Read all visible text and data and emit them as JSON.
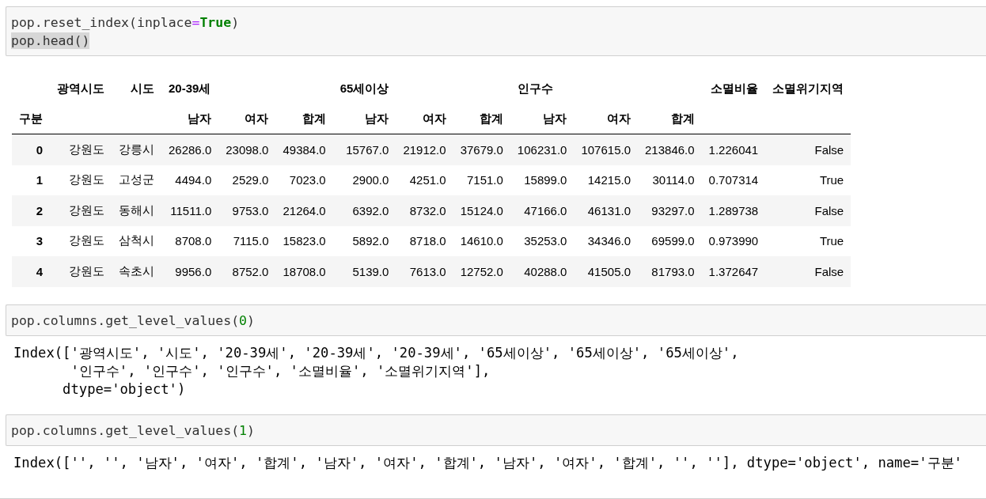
{
  "cells": [
    {
      "kind": "code",
      "lines": [
        [
          {
            "kind": "plain",
            "text": "pop.reset_index(inplace"
          },
          {
            "kind": "operator",
            "text": "="
          },
          {
            "kind": "keyword",
            "text": "True"
          },
          {
            "kind": "plain",
            "text": ")"
          }
        ],
        [
          {
            "kind": "plain",
            "text": "pop.head()",
            "selected": true
          }
        ]
      ]
    },
    {
      "kind": "table",
      "columns": [
        "광역시도",
        "시도",
        "20-39세",
        "",
        "",
        "65세이상",
        "",
        "",
        "인구수",
        "",
        "",
        "소멸비율",
        "소멸위기지역"
      ],
      "subcolumns": [
        "",
        "",
        "남자",
        "여자",
        "합계",
        "남자",
        "여자",
        "합계",
        "남자",
        "여자",
        "합계",
        "",
        ""
      ],
      "index_name": "구분",
      "rows": [
        {
          "index": "0",
          "cells": [
            "강원도",
            "강릉시",
            "26286.0",
            "23098.0",
            "49384.0",
            "15767.0",
            "21912.0",
            "37679.0",
            "106231.0",
            "107615.0",
            "213846.0",
            "1.226041",
            "False"
          ]
        },
        {
          "index": "1",
          "cells": [
            "강원도",
            "고성군",
            "4494.0",
            "2529.0",
            "7023.0",
            "2900.0",
            "4251.0",
            "7151.0",
            "15899.0",
            "14215.0",
            "30114.0",
            "0.707314",
            "True"
          ]
        },
        {
          "index": "2",
          "cells": [
            "강원도",
            "동해시",
            "11511.0",
            "9753.0",
            "21264.0",
            "6392.0",
            "8732.0",
            "15124.0",
            "47166.0",
            "46131.0",
            "93297.0",
            "1.289738",
            "False"
          ]
        },
        {
          "index": "3",
          "cells": [
            "강원도",
            "삼척시",
            "8708.0",
            "7115.0",
            "15823.0",
            "5892.0",
            "8718.0",
            "14610.0",
            "35253.0",
            "34346.0",
            "69599.0",
            "0.973990",
            "True"
          ]
        },
        {
          "index": "4",
          "cells": [
            "강원도",
            "속초시",
            "9956.0",
            "8752.0",
            "18708.0",
            "5139.0",
            "7613.0",
            "12752.0",
            "40288.0",
            "41505.0",
            "81793.0",
            "1.372647",
            "False"
          ]
        }
      ]
    },
    {
      "kind": "code",
      "lines": [
        [
          {
            "kind": "plain",
            "text": "pop.columns.get_level_values("
          },
          {
            "kind": "number",
            "text": "0"
          },
          {
            "kind": "plain",
            "text": ")"
          }
        ]
      ]
    },
    {
      "kind": "output",
      "lines": [
        "Index(['광역시도', '시도', '20-39세', '20-39세', '20-39세', '65세이상', '65세이상', '65세이상',",
        "       '인구수', '인구수', '인구수', '소멸비율', '소멸위기지역'],",
        "      dtype='object')"
      ]
    },
    {
      "kind": "code",
      "lines": [
        [
          {
            "kind": "plain",
            "text": "pop.columns.get_level_values("
          },
          {
            "kind": "number",
            "text": "1"
          },
          {
            "kind": "plain",
            "text": ")"
          }
        ]
      ]
    },
    {
      "kind": "output",
      "lines": [
        "Index(['', '', '남자', '여자', '합계', '남자', '여자', '합계', '남자', '여자', '합계', '', ''], dtype='object', name='구분'"
      ]
    }
  ]
}
